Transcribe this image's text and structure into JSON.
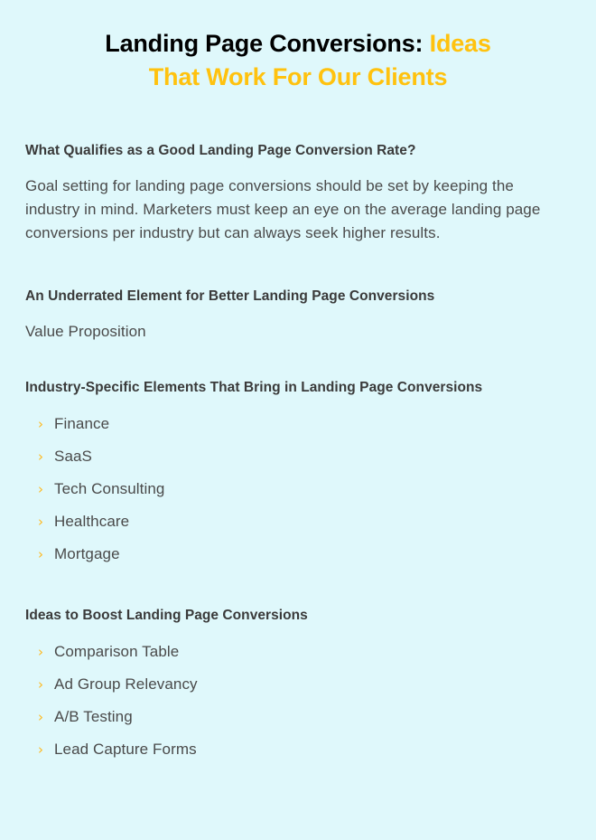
{
  "article": {
    "title": {
      "lead": "Landing Page Conversions:",
      "accent_part_one": " Ideas",
      "accent_part_two": "That Work For Our Clients"
    },
    "sections": [
      {
        "heading": "What Qualifies as a Good Landing Page Conversion Rate?",
        "paragraph": "Goal setting for landing page conversions should be set by keeping the industry in mind. Marketers must keep an eye on the average landing page conversions per industry but can always seek higher results."
      },
      {
        "heading": "An Underrated Element for Better Landing Page Conversions",
        "paragraph": "Value Proposition"
      },
      {
        "heading": "Industry-Specific Elements That Bring in Landing Page Conversions",
        "items": [
          "Finance",
          "SaaS",
          "Tech Consulting",
          "Healthcare",
          "Mortgage"
        ]
      },
      {
        "heading": "Ideas to Boost Landing Page Conversions",
        "items": [
          "Comparison Table",
          "Ad Group Relevancy",
          "A/B Testing",
          "Lead Capture Forms"
        ]
      }
    ],
    "bullet_glyph": "›",
    "colors": {
      "background": "#dff8fb",
      "accent": "#ffc20e",
      "bullet": "#ffb81c",
      "heading": "#3a3a3a",
      "body": "#4a4a4a",
      "title_lead": "#000000"
    }
  }
}
